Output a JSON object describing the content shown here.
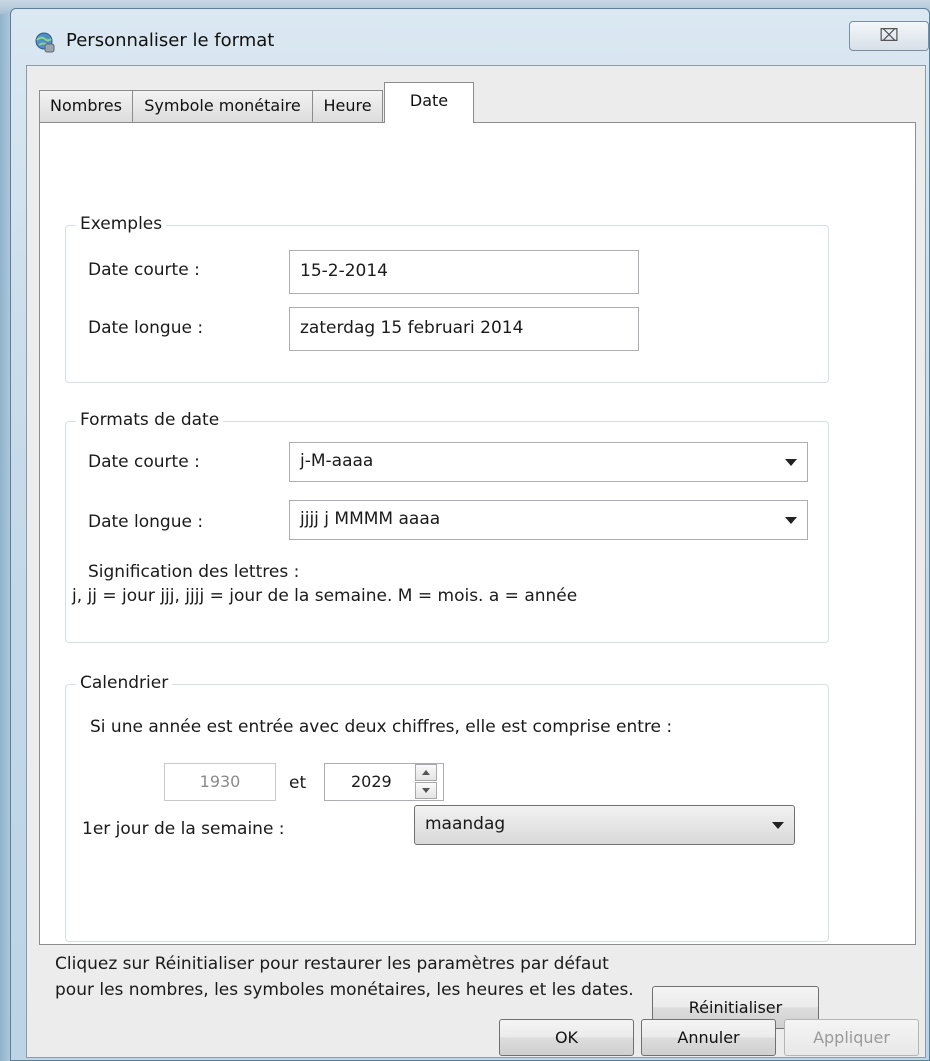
{
  "window": {
    "title": "Personnaliser le format",
    "close_glyph": "⌧"
  },
  "tabs": [
    {
      "label": "Nombres"
    },
    {
      "label": "Symbole monétaire"
    },
    {
      "label": "Heure"
    },
    {
      "label": "Date",
      "active": true
    }
  ],
  "examples": {
    "group_label": "Exemples",
    "short_label": "Date courte :",
    "short_value": "15-2-2014",
    "long_label": "Date longue :",
    "long_value": "zaterdag 15 februari 2014"
  },
  "formats": {
    "group_label": "Formats de date",
    "short_label": "Date courte :",
    "short_value": "j-M-aaaa",
    "long_label": "Date longue :",
    "long_value": "jjjj j MMMM aaaa",
    "legend_title": "Signification des lettres :",
    "legend_text": "j, jj = jour  jjj, jjjj = jour de la semaine. M = mois. a = année"
  },
  "calendar": {
    "group_label": "Calendrier",
    "two_digit_text": "Si une année est entrée avec deux chiffres, elle est comprise entre :",
    "year_from": "1930",
    "and_label": "et",
    "year_to": "2029",
    "first_day_label": "1er jour de la semaine :",
    "first_day_value": "maandag"
  },
  "footer": {
    "reset_info": "Cliquez sur Réinitialiser pour restaurer les paramètres par défaut pour les nombres, les symboles monétaires, les heures et les dates.",
    "reset_label": "Réinitialiser",
    "ok_label": "OK",
    "cancel_label": "Annuler",
    "apply_label": "Appliquer"
  }
}
